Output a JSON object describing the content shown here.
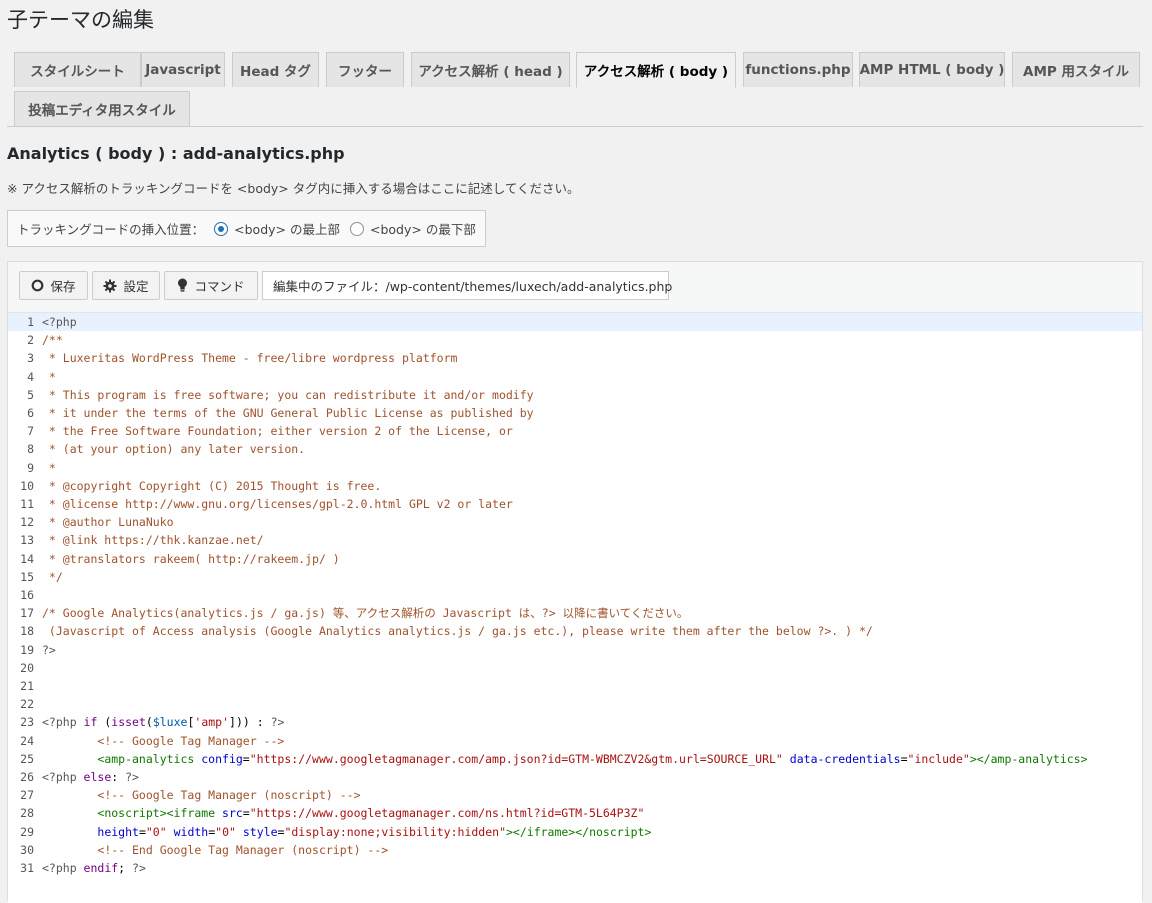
{
  "page": {
    "title": "子テーマの編集"
  },
  "tabs": [
    {
      "label": "スタイルシート",
      "active": false
    },
    {
      "label": "Javascript",
      "active": false
    },
    {
      "label": "Head タグ",
      "active": false
    },
    {
      "label": "フッター",
      "active": false
    },
    {
      "label": "アクセス解析 ( head )",
      "active": false
    },
    {
      "label": "アクセス解析 ( body )",
      "active": true
    },
    {
      "label": "functions.php",
      "active": false
    },
    {
      "label": "AMP HTML ( body )",
      "active": false
    },
    {
      "label": "AMP 用スタイル",
      "active": false
    },
    {
      "label": "投稿エディタ用スタイル",
      "active": false
    }
  ],
  "section": {
    "title": "Analytics ( body ) :  add-analytics.php",
    "note": "※ アクセス解析のトラッキングコードを <body> タグ内に挿入する場合はここに記述してください。"
  },
  "insert_position": {
    "label": "トラッキングコードの挿入位置：",
    "options": [
      {
        "label": "<body> の最上部",
        "checked": true
      },
      {
        "label": "<body> の最下部",
        "checked": false
      }
    ]
  },
  "toolbar": {
    "save_label": "保存",
    "settings_label": "設定",
    "command_label": "コマンド",
    "file_label": "編集中のファイル：/wp-content/themes/luxech/add-analytics.php"
  },
  "editor": {
    "active_line": 1,
    "lines": [
      [
        [
          "meta",
          "<?php"
        ]
      ],
      [
        [
          "comment",
          "/**"
        ]
      ],
      [
        [
          "comment",
          " * Luxeritas WordPress Theme - free/libre wordpress platform"
        ]
      ],
      [
        [
          "comment",
          " *"
        ]
      ],
      [
        [
          "comment",
          " * This program is free software; you can redistribute it and/or modify"
        ]
      ],
      [
        [
          "comment",
          " * it under the terms of the GNU General Public License as published by"
        ]
      ],
      [
        [
          "comment",
          " * the Free Software Foundation; either version 2 of the License, or"
        ]
      ],
      [
        [
          "comment",
          " * (at your option) any later version."
        ]
      ],
      [
        [
          "comment",
          " *"
        ]
      ],
      [
        [
          "comment",
          " * @copyright Copyright (C) 2015 Thought is free."
        ]
      ],
      [
        [
          "comment",
          " * @license http://www.gnu.org/licenses/gpl-2.0.html GPL v2 or later"
        ]
      ],
      [
        [
          "comment",
          " * @author LunaNuko"
        ]
      ],
      [
        [
          "comment",
          " * @link https://thk.kanzae.net/"
        ]
      ],
      [
        [
          "comment",
          " * @translators rakeem( http://rakeem.jp/ )"
        ]
      ],
      [
        [
          "comment",
          " */"
        ]
      ],
      [],
      [
        [
          "comment",
          "/* Google Analytics(analytics.js / ga.js) 等、アクセス解析の Javascript は、?> 以降に書いてください。"
        ]
      ],
      [
        [
          "comment",
          " (Javascript of Access analysis (Google Analytics analytics.js / ga.js etc.), please write them after the below ?>. ) */"
        ]
      ],
      [
        [
          "meta",
          "?>"
        ]
      ],
      [],
      [],
      [],
      [
        [
          "meta",
          "<?php "
        ],
        [
          "kw",
          "if"
        ],
        [
          "plain",
          " ("
        ],
        [
          "kw",
          "isset"
        ],
        [
          "plain",
          "("
        ],
        [
          "var",
          "$luxe"
        ],
        [
          "plain",
          "["
        ],
        [
          "str",
          "'amp'"
        ],
        [
          "plain",
          "])) : "
        ],
        [
          "meta",
          "?>"
        ]
      ],
      [
        [
          "plain",
          "        "
        ],
        [
          "comment",
          "<!-- Google Tag Manager -->"
        ]
      ],
      [
        [
          "plain",
          "        "
        ],
        [
          "tag",
          "<amp-analytics "
        ],
        [
          "attr",
          "config"
        ],
        [
          "plain",
          "="
        ],
        [
          "astr",
          "\"https://www.googletagmanager.com/amp.json?id=GTM-WBMCZV2&gtm.url=SOURCE_URL\""
        ],
        [
          "plain",
          " "
        ],
        [
          "attr",
          "data-credentials"
        ],
        [
          "plain",
          "="
        ],
        [
          "astr",
          "\"include\""
        ],
        [
          "tag",
          "></amp-analytics>"
        ]
      ],
      [
        [
          "meta",
          "<?php "
        ],
        [
          "kw",
          "else"
        ],
        [
          "plain",
          ": "
        ],
        [
          "meta",
          "?>"
        ]
      ],
      [
        [
          "plain",
          "        "
        ],
        [
          "comment",
          "<!-- Google Tag Manager (noscript) -->"
        ]
      ],
      [
        [
          "plain",
          "        "
        ],
        [
          "tag",
          "<noscript><iframe "
        ],
        [
          "attr",
          "src"
        ],
        [
          "plain",
          "="
        ],
        [
          "astr",
          "\"https://www.googletagmanager.com/ns.html?id=GTM-5L64P3Z\""
        ]
      ],
      [
        [
          "plain",
          "        "
        ],
        [
          "attr",
          "height"
        ],
        [
          "plain",
          "="
        ],
        [
          "astr",
          "\"0\""
        ],
        [
          "plain",
          " "
        ],
        [
          "attr",
          "width"
        ],
        [
          "plain",
          "="
        ],
        [
          "astr",
          "\"0\""
        ],
        [
          "plain",
          " "
        ],
        [
          "attr",
          "style"
        ],
        [
          "plain",
          "="
        ],
        [
          "astr",
          "\"display:none;visibility:hidden\""
        ],
        [
          "tag",
          "></iframe></noscript>"
        ]
      ],
      [
        [
          "plain",
          "        "
        ],
        [
          "comment",
          "<!-- End Google Tag Manager (noscript) -->"
        ]
      ],
      [
        [
          "meta",
          "<?php "
        ],
        [
          "kw",
          "endif"
        ],
        [
          "plain",
          "; "
        ],
        [
          "meta",
          "?>"
        ]
      ]
    ]
  }
}
